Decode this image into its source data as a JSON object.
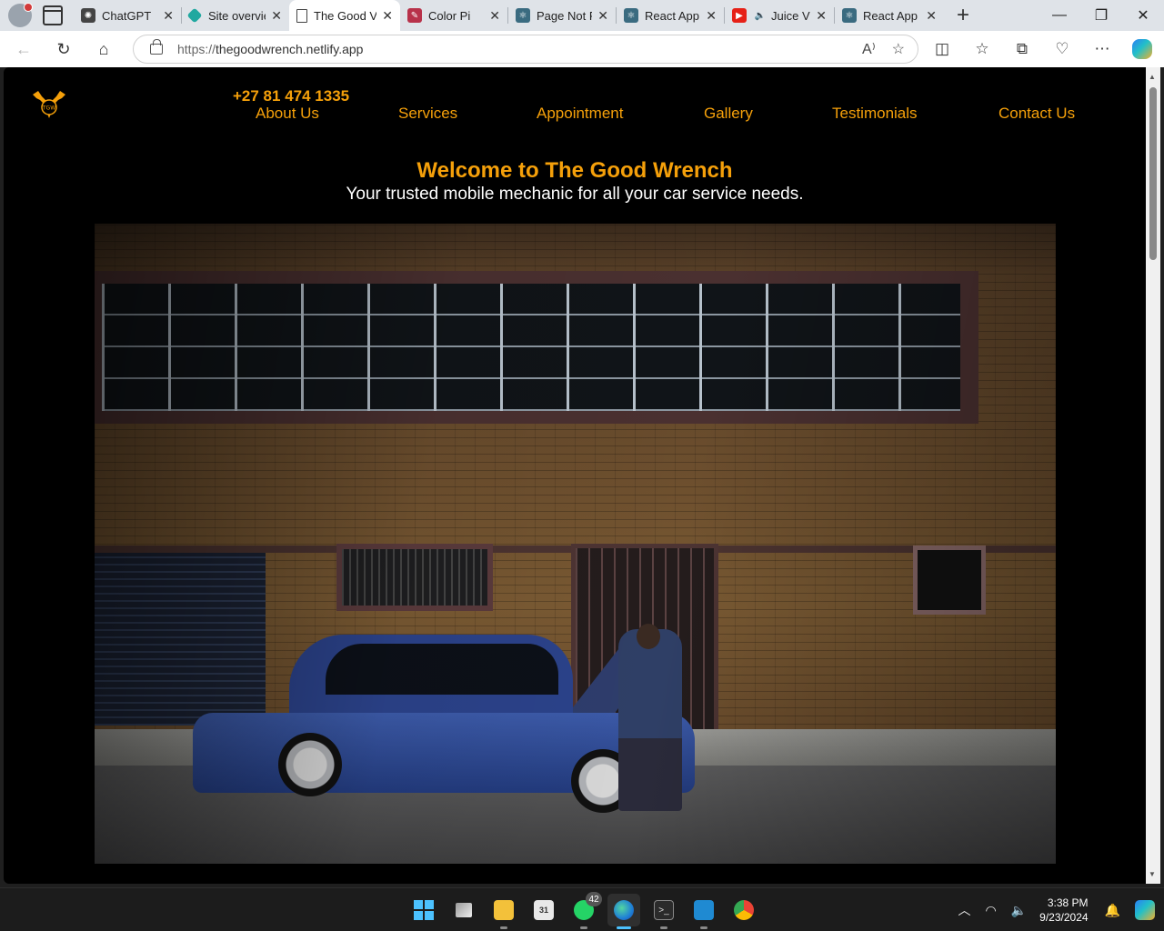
{
  "browser": {
    "tabs": [
      {
        "title": "ChatGPT",
        "icon": "chatgpt-icon",
        "color": "#444444"
      },
      {
        "title": "Site overvie",
        "icon": "netlify-icon",
        "color": "#20a8a0"
      },
      {
        "title": "The Good V",
        "icon": "page-icon",
        "color": "#ffffff",
        "active": true
      },
      {
        "title": "Color Pi",
        "icon": "color-picker-icon",
        "color": "#b8324a"
      },
      {
        "title": "Page Not Fo",
        "icon": "react-icon",
        "color": "#3a6b80"
      },
      {
        "title": "React App",
        "icon": "react-icon",
        "color": "#3a6b80"
      },
      {
        "title": "Juice V",
        "icon": "youtube-icon",
        "color": "#e62117"
      },
      {
        "title": "React App",
        "icon": "react-icon",
        "color": "#3a6b80"
      }
    ],
    "url": "https://thegoodwrench.netlify.app",
    "url_protocol": "https://",
    "url_host": "thegoodwrench.netlify.app"
  },
  "site": {
    "logo_text": "TGW",
    "phone": "+27 81 474 1335",
    "nav": [
      "About Us",
      "Services",
      "Appointment",
      "Gallery",
      "Testimonials",
      "Contact Us"
    ],
    "hero_title": "Welcome to The Good Wrench",
    "hero_subtitle": "Your trusted mobile mechanic for all your car service needs.",
    "accent_color": "#f5a00a",
    "background_color": "#000000"
  },
  "taskbar": {
    "apps": [
      "start",
      "task-view",
      "file-explorer",
      "calendar",
      "whatsapp",
      "edge",
      "terminal",
      "vscode",
      "chrome"
    ],
    "whatsapp_badge": "42",
    "time": "3:38 PM",
    "date": "9/23/2024"
  }
}
